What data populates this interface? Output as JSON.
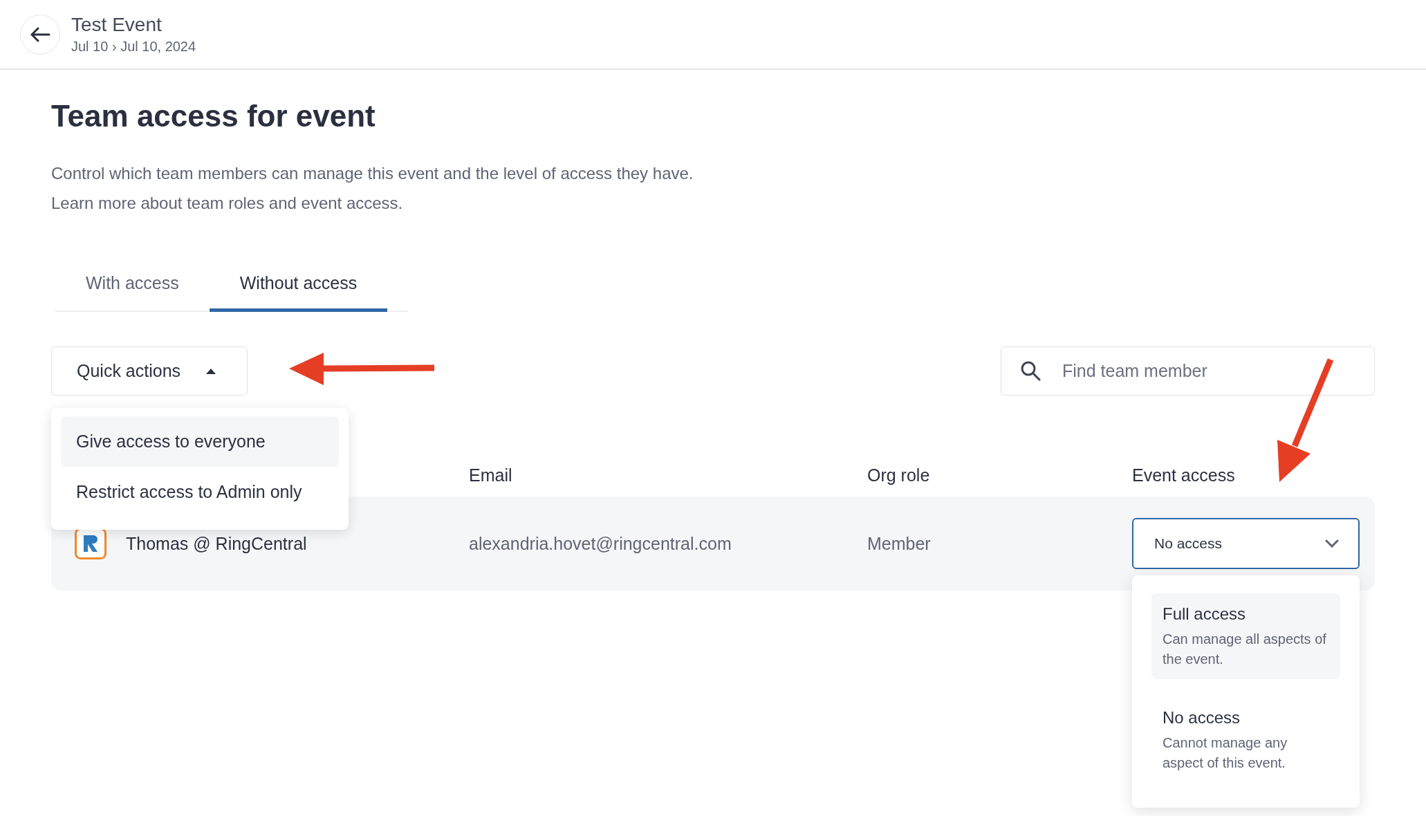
{
  "header": {
    "title": "Test Event",
    "dates": "Jul 10 › Jul 10, 2024"
  },
  "page": {
    "title": "Team access for event",
    "description": "Control which team members can manage this event and the level of access they have. Learn more about team roles and event access."
  },
  "tabs": [
    {
      "label": "With access",
      "selected": false
    },
    {
      "label": "Without access",
      "selected": true
    }
  ],
  "quick_actions": {
    "label": "Quick actions",
    "expanded": true,
    "items": [
      {
        "label": "Give access to everyone",
        "highlighted": true
      },
      {
        "label": "Restrict access to Admin only",
        "highlighted": false
      }
    ]
  },
  "search": {
    "placeholder": "Find team member"
  },
  "table": {
    "columns": [
      "Email",
      "Org role",
      "Event access"
    ],
    "rows": [
      {
        "name": "Thomas @ RingCentral",
        "email": "alexandria.hovet@ringcentral.com",
        "org_role": "Member",
        "event_access": "No access",
        "expanded": true
      }
    ]
  },
  "access_options": [
    {
      "title": "Full access",
      "description": "Can manage all aspects of the event.",
      "highlighted": true
    },
    {
      "title": "No access",
      "description": "Cannot manage any aspect of this event.",
      "highlighted": false
    }
  ]
}
